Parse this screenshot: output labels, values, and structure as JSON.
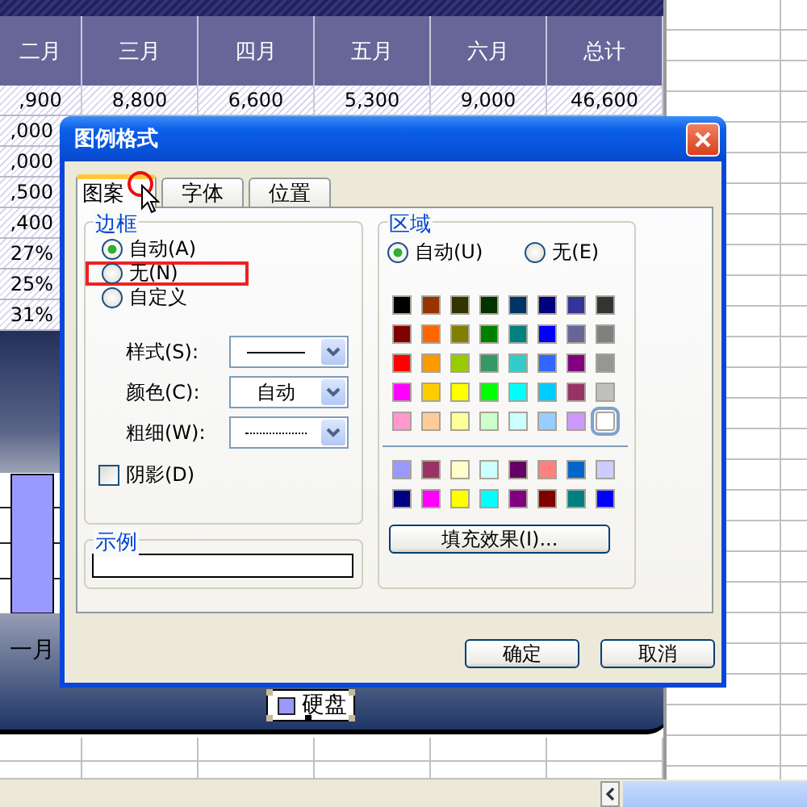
{
  "sheet": {
    "columns": [
      "二月",
      "三月",
      "四月",
      "五月",
      "六月",
      "总计"
    ],
    "first_row": [
      ",900",
      "8,800",
      "6,600",
      "5,300",
      "9,000",
      "46,600"
    ],
    "left_cells": [
      ",000",
      ",000",
      ",500",
      ",400",
      "27%",
      "25%",
      "31%"
    ]
  },
  "chart": {
    "category_label": "一月",
    "legend": {
      "label": "硬盘",
      "color": "#9999ff",
      "selected": true
    }
  },
  "dialog": {
    "title": "图例格式",
    "tabs": [
      {
        "label": "图案",
        "selected": true
      },
      {
        "label": "字体",
        "selected": false
      },
      {
        "label": "位置",
        "selected": false
      }
    ],
    "border": {
      "title": "边框",
      "options": [
        {
          "label": "自动(A)",
          "selected": true,
          "highlighted": false
        },
        {
          "label": "无(N)",
          "selected": false,
          "highlighted": true
        },
        {
          "label": "自定义",
          "selected": false,
          "highlighted": false
        }
      ],
      "fields": [
        {
          "label": "样式(S):",
          "kind": "solid"
        },
        {
          "label": "颜色(C):",
          "kind": "text",
          "value": "自动"
        },
        {
          "label": "粗细(W):",
          "kind": "dotted"
        }
      ],
      "shadow": {
        "label": "阴影(D)",
        "checked": false
      }
    },
    "sample": {
      "title": "示例"
    },
    "area": {
      "title": "区域",
      "options": [
        {
          "label": "自动(U)",
          "selected": true
        },
        {
          "label": "无(E)",
          "selected": false
        }
      ],
      "palette": [
        {
          "color": "#000000",
          "selected": false
        },
        {
          "color": "#993300",
          "selected": false
        },
        {
          "color": "#333300",
          "selected": false
        },
        {
          "color": "#003300",
          "selected": false
        },
        {
          "color": "#003366",
          "selected": false
        },
        {
          "color": "#000080",
          "selected": false
        },
        {
          "color": "#333399",
          "selected": false
        },
        {
          "color": "#333333",
          "selected": false
        },
        {
          "color": "#800000",
          "selected": false
        },
        {
          "color": "#ff6600",
          "selected": false
        },
        {
          "color": "#808000",
          "selected": false
        },
        {
          "color": "#008000",
          "selected": false
        },
        {
          "color": "#008080",
          "selected": false
        },
        {
          "color": "#0000ff",
          "selected": false
        },
        {
          "color": "#666699",
          "selected": false
        },
        {
          "color": "#808080",
          "selected": false
        },
        {
          "color": "#ff0000",
          "selected": false
        },
        {
          "color": "#ff9900",
          "selected": false
        },
        {
          "color": "#99cc00",
          "selected": false
        },
        {
          "color": "#339966",
          "selected": false
        },
        {
          "color": "#33cccc",
          "selected": false
        },
        {
          "color": "#3366ff",
          "selected": false
        },
        {
          "color": "#800080",
          "selected": false
        },
        {
          "color": "#969696",
          "selected": false
        },
        {
          "color": "#ff00ff",
          "selected": false
        },
        {
          "color": "#ffcc00",
          "selected": false
        },
        {
          "color": "#ffff00",
          "selected": false
        },
        {
          "color": "#00ff00",
          "selected": false
        },
        {
          "color": "#00ffff",
          "selected": false
        },
        {
          "color": "#00ccff",
          "selected": false
        },
        {
          "color": "#993366",
          "selected": false
        },
        {
          "color": "#c0c0c0",
          "selected": false
        },
        {
          "color": "#ff99cc",
          "selected": false
        },
        {
          "color": "#ffcc99",
          "selected": false
        },
        {
          "color": "#ffff99",
          "selected": false
        },
        {
          "color": "#ccffcc",
          "selected": false
        },
        {
          "color": "#ccffff",
          "selected": false
        },
        {
          "color": "#99ccff",
          "selected": false
        },
        {
          "color": "#cc99ff",
          "selected": false
        },
        {
          "color": "#ffffff",
          "selected": true
        }
      ],
      "extra_palette": [
        {
          "color": "#9999ff",
          "selected": false
        },
        {
          "color": "#993366",
          "selected": false
        },
        {
          "color": "#ffffcc",
          "selected": false
        },
        {
          "color": "#ccffff",
          "selected": false
        },
        {
          "color": "#660066",
          "selected": false
        },
        {
          "color": "#ff8080",
          "selected": false
        },
        {
          "color": "#0066cc",
          "selected": false
        },
        {
          "color": "#ccccff",
          "selected": false
        },
        {
          "color": "#000080",
          "selected": false
        },
        {
          "color": "#ff00ff",
          "selected": false
        },
        {
          "color": "#ffff00",
          "selected": false
        },
        {
          "color": "#00ffff",
          "selected": false
        },
        {
          "color": "#800080",
          "selected": false
        },
        {
          "color": "#800000",
          "selected": false
        },
        {
          "color": "#008080",
          "selected": false
        },
        {
          "color": "#0000ff",
          "selected": false
        }
      ],
      "fill_button": "填充效果(I)..."
    },
    "buttons": [
      "确定",
      "取消"
    ]
  }
}
